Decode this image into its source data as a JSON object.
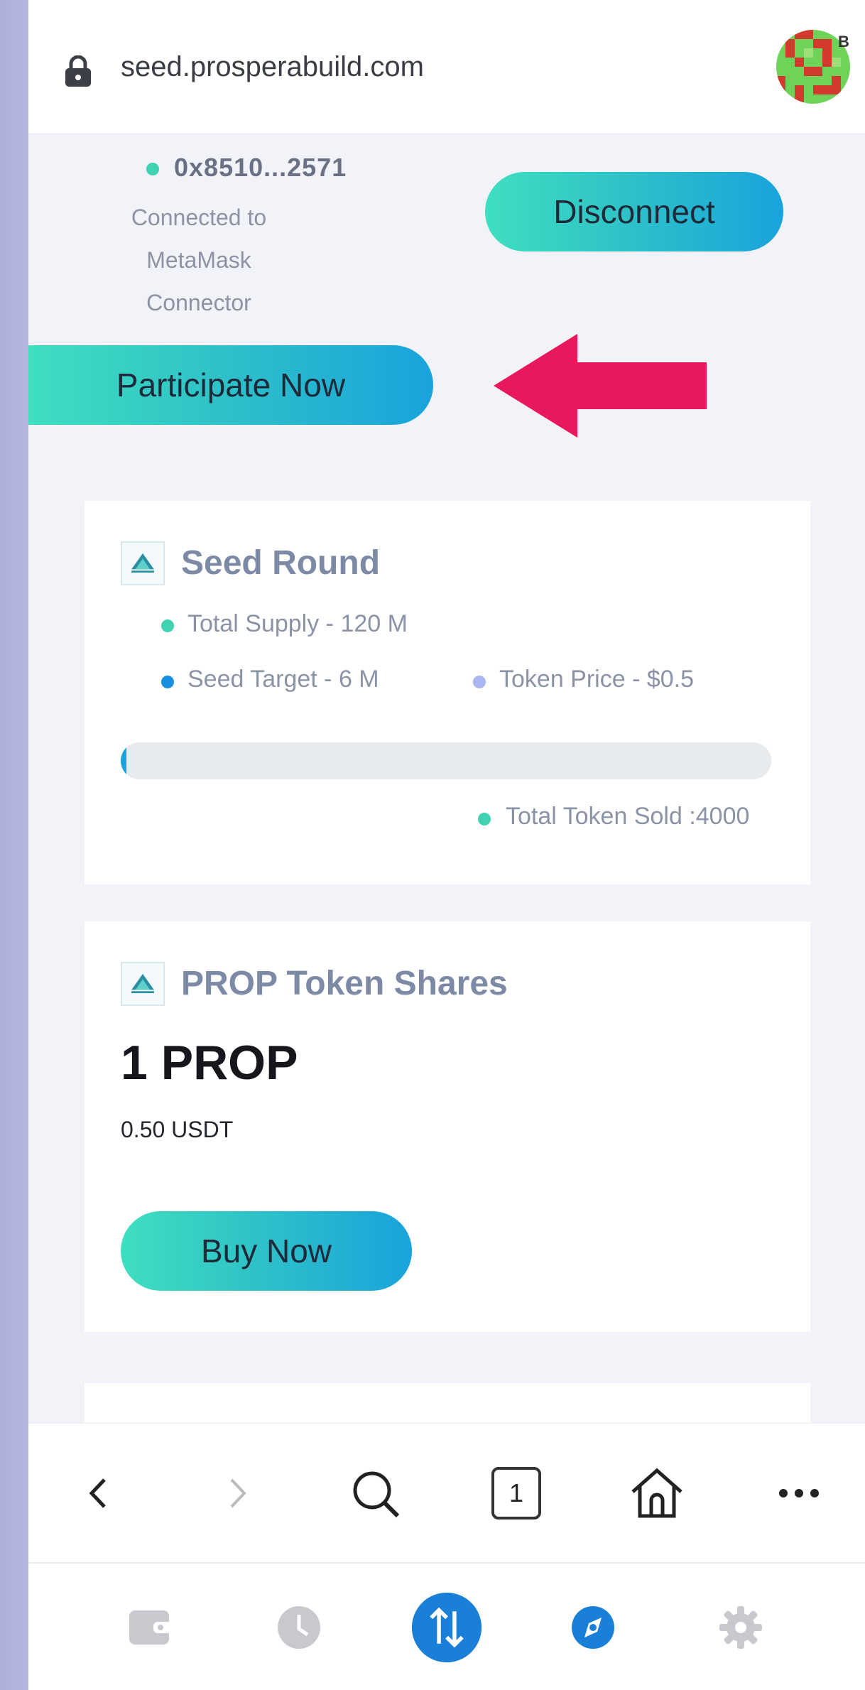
{
  "browser": {
    "url": "seed.prosperabuild.com",
    "avatar_badge": "B",
    "tab_count": "1"
  },
  "wallet": {
    "address": "0x8510...2571",
    "status_line1": "Connected to MetaMask",
    "status_line2": "Connector",
    "disconnect_label": "Disconnect"
  },
  "participate_label": "Participate Now",
  "seed_round": {
    "title": "Seed Round",
    "total_supply": "Total Supply - 120 M",
    "seed_target": "Seed Target - 6 M",
    "token_price": "Token Price - $0.5",
    "progress_fraction": 0.0007,
    "total_sold": "Total Token Sold :4000"
  },
  "prop_shares": {
    "title": "PROP Token Shares",
    "amount": "1 PROP",
    "price": "0.50 USDT",
    "buy_label": "Buy Now"
  },
  "colors": {
    "accent_teal": "#3fdfc0",
    "accent_blue": "#19a3dc",
    "arrow_red": "#e8185c",
    "title_gray": "#7d8aa6",
    "dot_teal": "#3fd3b2",
    "dot_blue": "#1a8ee0",
    "dot_lavender": "#a9b6f2"
  },
  "icons": {
    "lock": "lock-icon",
    "back": "chevron-left-icon",
    "forward": "chevron-right-icon",
    "search": "search-icon",
    "tabs": "tabs-icon",
    "home": "home-icon",
    "more": "more-icon",
    "wallet": "wallet-icon",
    "history": "clock-icon",
    "swap": "swap-icon",
    "browser": "compass-icon",
    "settings": "gear-icon"
  }
}
